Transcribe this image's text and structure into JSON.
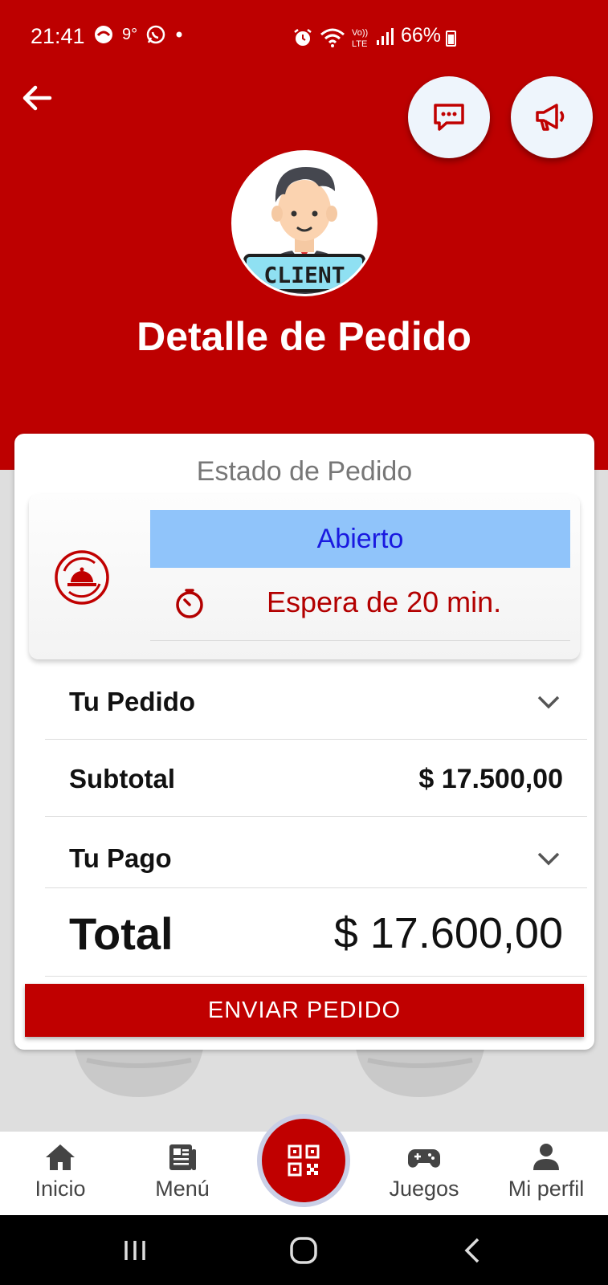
{
  "status_bar": {
    "time": "21:41",
    "temperature": "9°",
    "battery": "66%",
    "icons": [
      "samsung-app-icon",
      "whatsapp-icon",
      "dot-icon",
      "alarm-icon",
      "wifi-icon",
      "volte-icon",
      "signal-icon",
      "battery-icon"
    ]
  },
  "header": {
    "title": "Detalle de Pedido",
    "avatar_label": "CLIENT",
    "background_color": "#bd0000"
  },
  "card": {
    "status_section_label": "Estado de Pedido",
    "status_value": "Abierto",
    "wait_text": "Espera de 20 min.",
    "order_label": "Tu Pedido",
    "subtotal_label": "Subtotal",
    "subtotal_value": "$ 17.500,00",
    "payment_label": "Tu Pago",
    "total_label": "Total",
    "total_value": "$ 17.600,00",
    "send_button": "ENVIAR PEDIDO"
  },
  "bottom_nav": {
    "items": [
      {
        "label": "Inicio",
        "icon": "home-icon"
      },
      {
        "label": "Menú",
        "icon": "menu-book-icon"
      },
      {
        "label": "Juegos",
        "icon": "gamepad-icon"
      },
      {
        "label": "Mi perfil",
        "icon": "person-icon"
      }
    ],
    "center_icon": "qr-code-icon"
  },
  "colors": {
    "brand_red": "#c00000",
    "status_blue_bg": "#90c4fa",
    "status_blue_text": "#1a1ae0"
  }
}
